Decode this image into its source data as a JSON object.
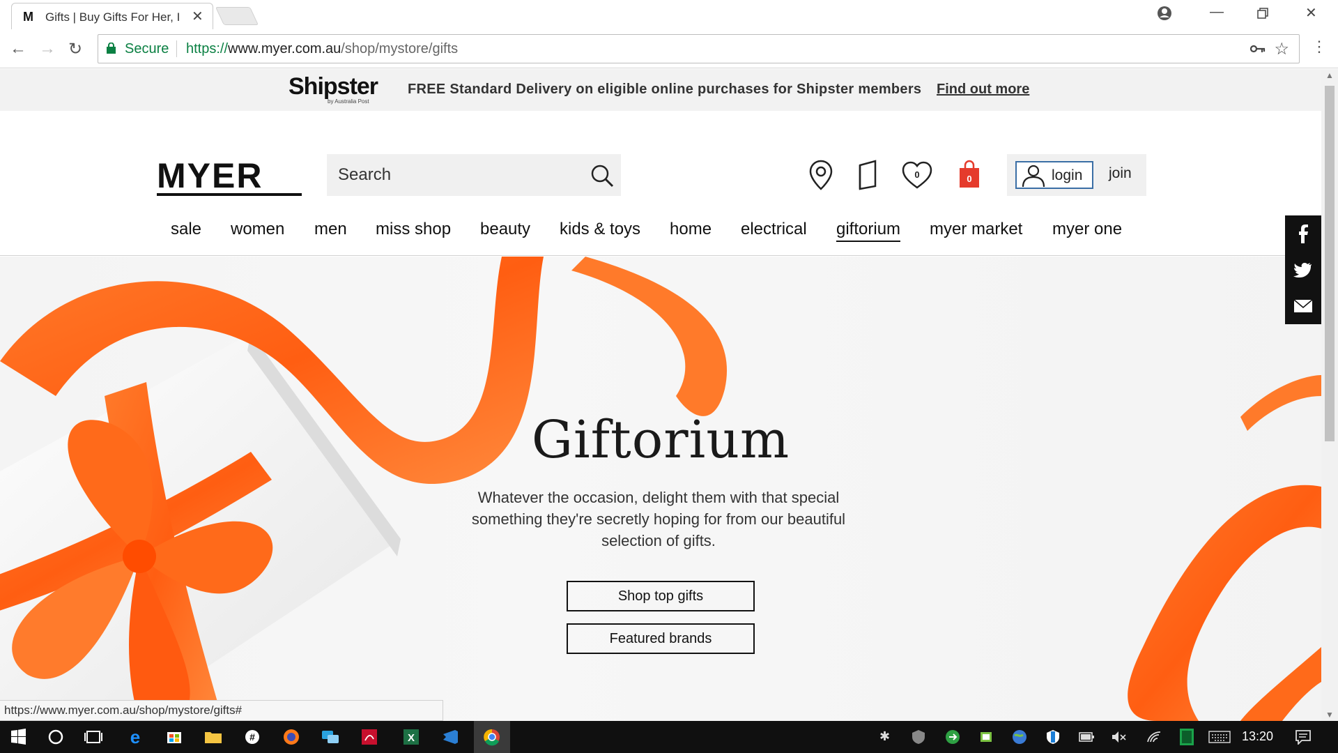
{
  "browser": {
    "tab_title": "Gifts | Buy Gifts For Her, I",
    "tab_favicon": "M",
    "secure_label": "Secure",
    "url_scheme": "https://",
    "url_host": "www.myer.com.au",
    "url_path": "/shop/mystore/gifts",
    "status_url": "https://www.myer.com.au/shop/mystore/gifts#"
  },
  "promo": {
    "logo": "Shipster",
    "logo_sub": "by Australia Post",
    "message": "FREE Standard Delivery on eligible online purchases for Shipster members",
    "link": "Find out more"
  },
  "header": {
    "logo": "MYER",
    "search_placeholder": "Search",
    "wishlist_count": "0",
    "bag_count": "0",
    "login_label": "login",
    "join_label": "join"
  },
  "nav": {
    "items": [
      "sale",
      "women",
      "men",
      "miss shop",
      "beauty",
      "kids & toys",
      "home",
      "electrical",
      "giftorium",
      "myer market",
      "myer one"
    ],
    "active": "giftorium"
  },
  "hero": {
    "title": "Giftorium",
    "subtitle": "Whatever the occasion, delight them with that special something they're secretly hoping for from our beautiful selection of gifts.",
    "btn_top_gifts": "Shop top gifts",
    "btn_featured": "Featured brands"
  },
  "taskbar": {
    "time": "13:20"
  },
  "colors": {
    "accent_red": "#e53b2c",
    "ribbon_orange": "#ff6a1a",
    "secure_green": "#0b8043"
  }
}
